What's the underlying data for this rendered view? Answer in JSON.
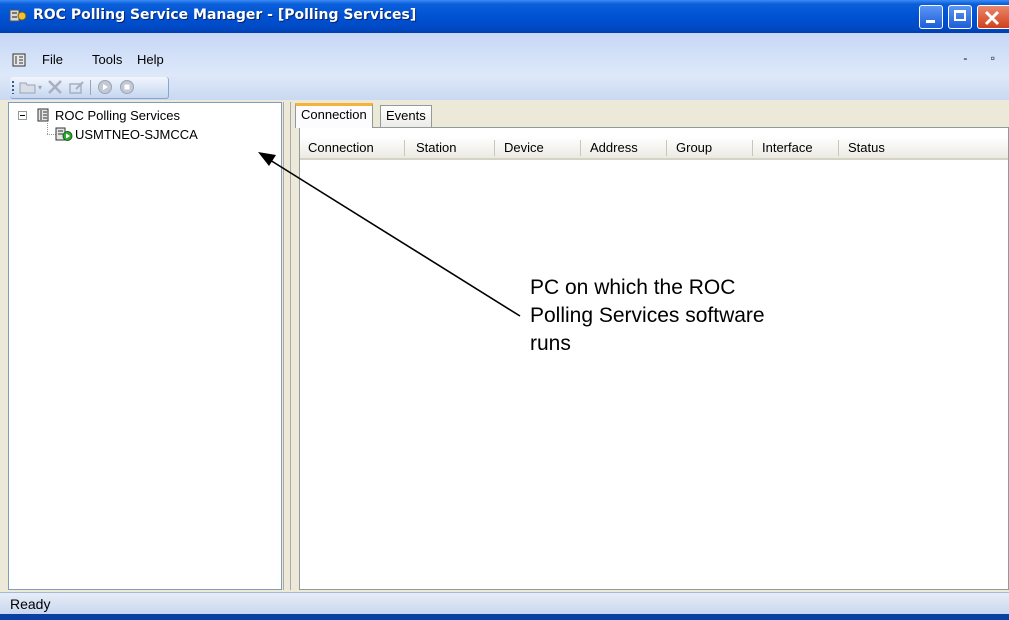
{
  "window": {
    "title": "ROC Polling Service Manager - [Polling Services]",
    "colors": {
      "titlebar": "#0052d4",
      "close_button": "#d1401c",
      "tab_highlight": "#f5b33a"
    }
  },
  "menu": {
    "file": "File",
    "tools": "Tools",
    "help": "Help",
    "mdi_controls": "- ▫"
  },
  "toolbar": {
    "icons": [
      "folder-icon",
      "delete-icon",
      "edit-icon",
      "start-icon",
      "stop-icon"
    ]
  },
  "tree": {
    "root_label": "ROC Polling Services",
    "child_label": "USMTNEO-SJMCCA"
  },
  "tabs": [
    "Connection",
    "Events"
  ],
  "table": {
    "columns": [
      "Connection",
      "Station",
      "Device",
      "Address",
      "Group",
      "Interface",
      "Status"
    ],
    "rows": []
  },
  "status": {
    "text": "Ready"
  },
  "annotation": {
    "text": "PC on which the ROC\nPolling Services software\nruns"
  }
}
